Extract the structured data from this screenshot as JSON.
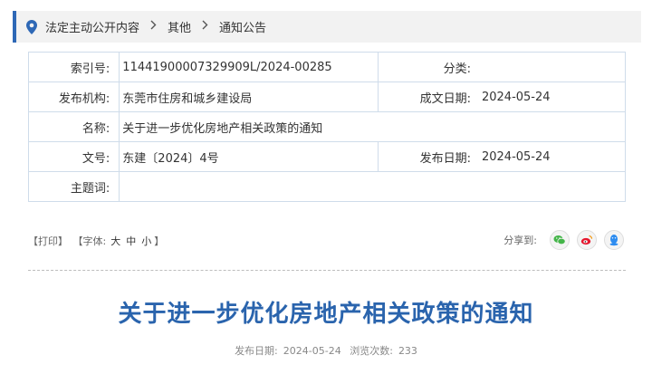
{
  "breadcrumb": {
    "items": [
      "法定主动公开内容",
      "其他",
      "通知公告"
    ],
    "separator": ">"
  },
  "info": {
    "index_label": "索引号:",
    "index_value": "11441900007329909L/2024-00285",
    "category_label": "分类:",
    "category_value": "",
    "publisher_label": "发布机构:",
    "publisher_value": "东莞市住房和城乡建设局",
    "written_date_label": "成文日期:",
    "written_date_value": "2024-05-24",
    "name_label": "名称:",
    "name_value": "关于进一步优化房地产相关政策的通知",
    "doc_no_label": "文号:",
    "doc_no_value": "东建〔2024〕4号",
    "publish_date_label": "发布日期:",
    "publish_date_value": "2024-05-24",
    "subject_label": "主题词:",
    "subject_value": ""
  },
  "tools": {
    "print": "【打印】",
    "font_prefix": "【字体:",
    "font_large": "大",
    "font_medium": "中",
    "font_small": "小",
    "font_suffix": "】"
  },
  "share": {
    "label": "分享到:",
    "icons": [
      "wechat-icon",
      "weibo-icon",
      "qq-icon"
    ]
  },
  "article": {
    "title": "关于进一步优化房地产相关政策的通知",
    "publish_label": "发布日期:",
    "publish_date": "2024-05-24",
    "views_label": "浏览次数:",
    "views": "233"
  },
  "colors": {
    "accent": "#2e68b6",
    "title": "#2a64ad",
    "border": "#cfdcea",
    "wechat": "#44b549",
    "weibo": "#e6162d",
    "qq": "#2d8cf0"
  }
}
